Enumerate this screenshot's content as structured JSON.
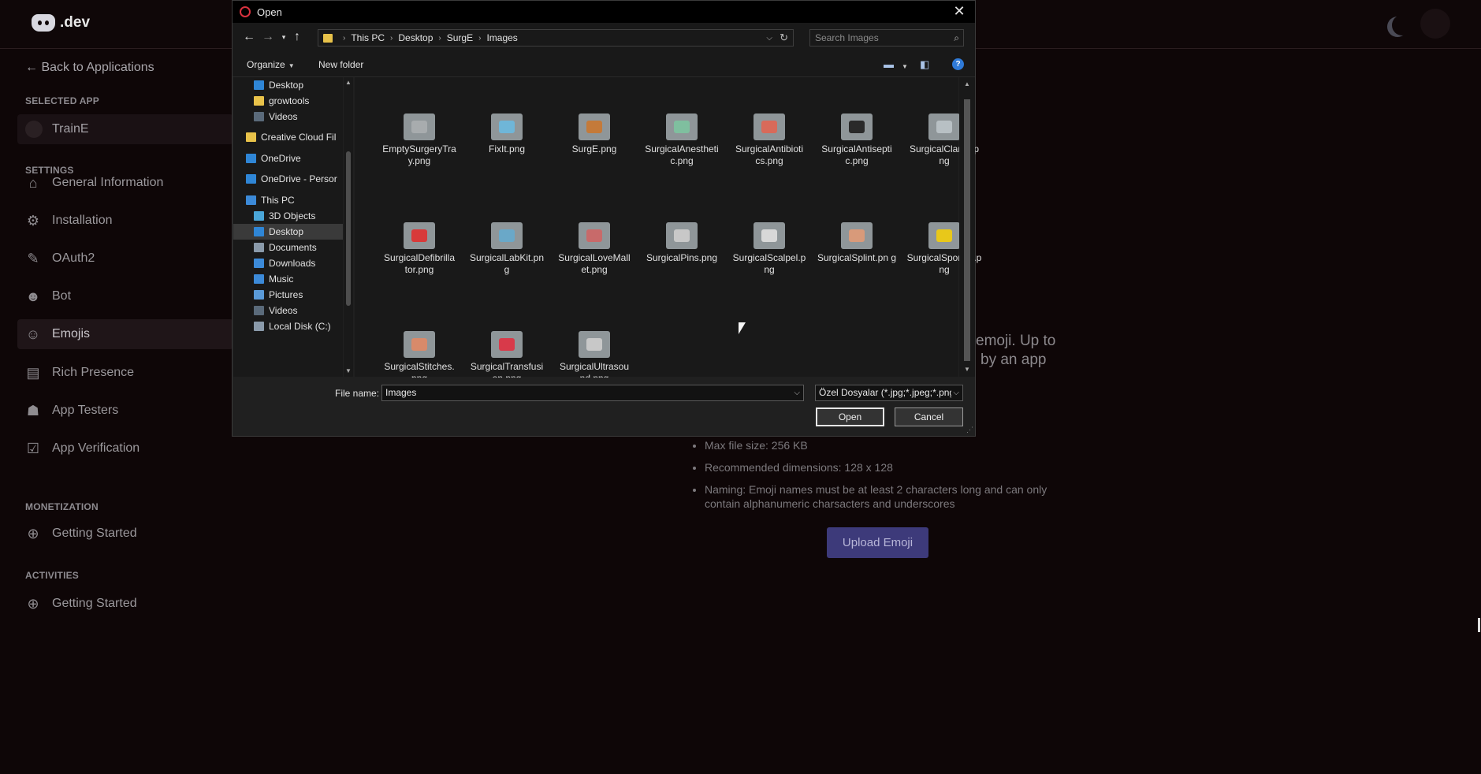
{
  "app": {
    "logo_text": ".dev",
    "back_label": "Back to Applications",
    "selected_app_label": "SELECTED APP",
    "selected_app_name": "TrainE",
    "settings_label": "SETTINGS",
    "nav": [
      {
        "label": "General Information",
        "icon": "home-icon"
      },
      {
        "label": "Installation",
        "icon": "gear-icon"
      },
      {
        "label": "OAuth2",
        "icon": "wrench-icon"
      },
      {
        "label": "Bot",
        "icon": "robot-icon"
      },
      {
        "label": "Emojis",
        "icon": "smile-icon",
        "active": true
      },
      {
        "label": "Rich Presence",
        "icon": "document-icon"
      },
      {
        "label": "App Testers",
        "icon": "person-icon"
      },
      {
        "label": "App Verification",
        "icon": "clipboard-check-icon"
      }
    ],
    "monetization_label": "MONETIZATION",
    "monetization_item": "Getting Started",
    "activities_label": "ACTIVITIES",
    "activities_item": "Getting Started",
    "partial_text_line1": "emoji. Up to",
    "partial_text_line2": "by an app",
    "bullets": [
      "Max file size: 256 KB",
      "Recommended dimensions: 128 x 128",
      "Naming: Emoji names must be at least 2 characters long and can only contain alphanumeric charsacters and underscores"
    ],
    "upload_button": "Upload Emoji"
  },
  "dialog": {
    "title": "Open",
    "breadcrumb": [
      "This PC",
      "Desktop",
      "SurgE",
      "Images"
    ],
    "search_placeholder": "Search Images",
    "organize_label": "Organize",
    "new_folder_label": "New folder",
    "tree": [
      {
        "label": "Desktop",
        "color": "#2f86d6"
      },
      {
        "label": "growtools",
        "color": "#e8c24a"
      },
      {
        "label": "Videos",
        "color": "#5a6a7a"
      },
      {
        "label": "Creative Cloud Fil",
        "color": "#e8c24a"
      },
      {
        "label": "OneDrive",
        "color": "#2f86d6"
      },
      {
        "label": "OneDrive - Persor",
        "color": "#2f86d6"
      },
      {
        "label": "This PC",
        "color": "#3c8ad8"
      },
      {
        "label": "3D Objects",
        "color": "#4aa6d8"
      },
      {
        "label": "Desktop",
        "color": "#2f86d6",
        "selected": true
      },
      {
        "label": "Documents",
        "color": "#8a9aaa"
      },
      {
        "label": "Downloads",
        "color": "#3c8ad8"
      },
      {
        "label": "Music",
        "color": "#3c8ad8"
      },
      {
        "label": "Pictures",
        "color": "#5a9ad8"
      },
      {
        "label": "Videos",
        "color": "#5a6a7a"
      },
      {
        "label": "Local Disk (C:)",
        "color": "#8a9aaa"
      }
    ],
    "files": [
      {
        "name": "EmptySurgeryTra y.png",
        "color": "#a8acae"
      },
      {
        "name": "FixIt.png",
        "color": "#6fb6d8"
      },
      {
        "name": "SurgE.png",
        "color": "#c47a3a"
      },
      {
        "name": "SurgicalAnestheti c.png",
        "color": "#7fbf9f"
      },
      {
        "name": "SurgicalAntibioti cs.png",
        "color": "#d86a5a"
      },
      {
        "name": "SurgicalAntisepti c.png",
        "color": "#2a2a2a"
      },
      {
        "name": "SurgicalClamp.p ng",
        "color": "#b8c0c4"
      },
      {
        "name": "SurgicalDefibrilla tor.png",
        "color": "#d83a3a"
      },
      {
        "name": "SurgicalLabKit.pn g",
        "color": "#6aa8c8"
      },
      {
        "name": "SurgicalLoveMall et.png",
        "color": "#c86a6a"
      },
      {
        "name": "SurgicalPins.png",
        "color": "#c8c8c8"
      },
      {
        "name": "SurgicalScalpel.p ng",
        "color": "#d8d8d8"
      },
      {
        "name": "SurgicalSplint.pn g",
        "color": "#d89a7a"
      },
      {
        "name": "SurgicalSponge.p ng",
        "color": "#e8c81a"
      },
      {
        "name": "SurgicalStitches. png",
        "color": "#d88a6a"
      },
      {
        "name": "SurgicalTransfusi on.png",
        "color": "#d83a4a"
      },
      {
        "name": "SurgicalUltrasou nd.png",
        "color": "#c8c8c8"
      }
    ],
    "file_name_label": "File name:",
    "file_name_value": "Images",
    "file_type_value": "Özel Dosyalar (*.jpg;*.jpeg;*.png",
    "open_button": "Open",
    "cancel_button": "Cancel"
  }
}
